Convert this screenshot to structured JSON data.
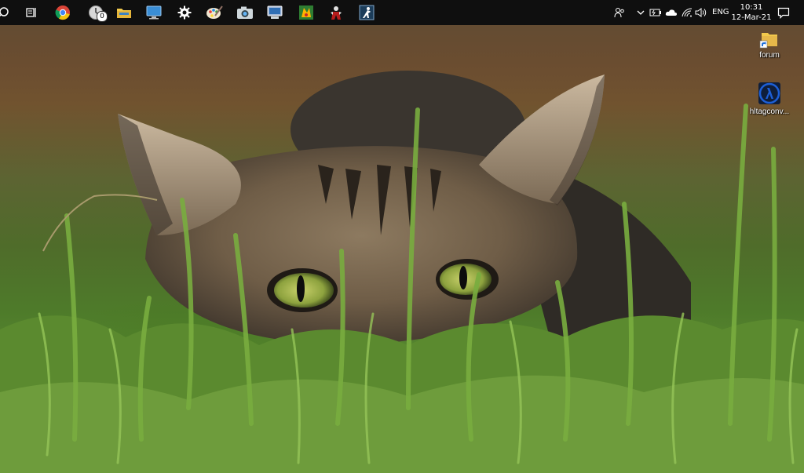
{
  "taskbar": {
    "pinned": [
      {
        "name": "search"
      },
      {
        "name": "task-view"
      },
      {
        "name": "chrome"
      },
      {
        "name": "clock-app",
        "badge": "0"
      },
      {
        "name": "file-explorer"
      },
      {
        "name": "remote-desktop"
      },
      {
        "name": "settings"
      },
      {
        "name": "paint"
      },
      {
        "name": "camera"
      },
      {
        "name": "network-manager"
      },
      {
        "name": "game-app"
      },
      {
        "name": "character-app"
      },
      {
        "name": "counter-strike"
      }
    ],
    "tray": {
      "language": "ENG",
      "time": "10:31",
      "date": "12-Mar-21"
    }
  },
  "desktop": {
    "icons": [
      {
        "label": "forum",
        "icon": "folder-shortcut"
      },
      {
        "label": "hltagconv...",
        "icon": "half-life-lambda"
      }
    ]
  },
  "colors": {
    "taskbar": "#0f0f0f",
    "folder": "#f2c94c",
    "lambda_bg": "#1d5fd6"
  }
}
